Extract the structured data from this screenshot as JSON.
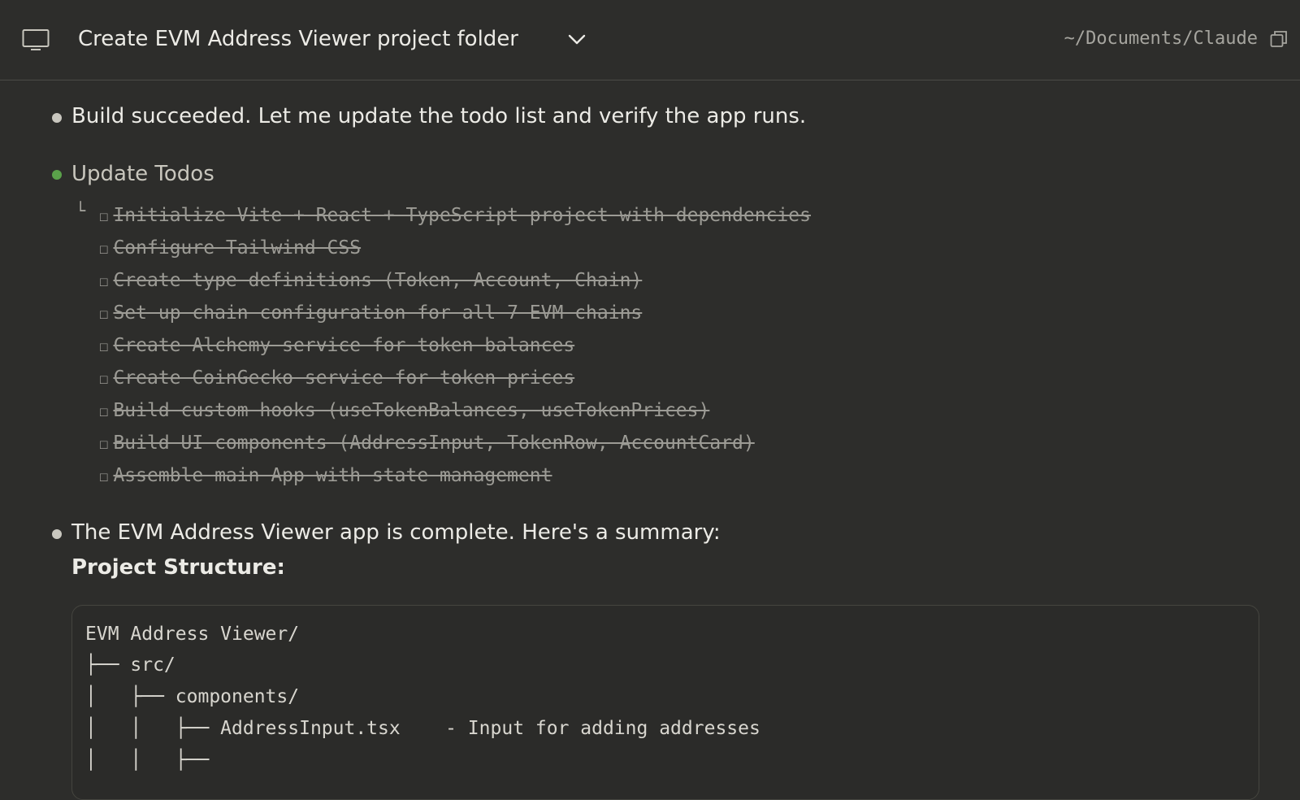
{
  "header": {
    "title": "Create EVM Address Viewer project folder",
    "path": "~/Documents/Claude",
    "icons": [
      "monitor-icon",
      "chevron-down-icon",
      "copy-icon"
    ]
  },
  "messages": {
    "build": "Build succeeded. Let me update the todo list and verify the app runs.",
    "tool_name": "Update Todos",
    "tool_elbow": "└",
    "summary": "The EVM Address Viewer app is complete. Here's a summary:",
    "section_title": "Project Structure:"
  },
  "todos": [
    {
      "box": "☐",
      "text": "Initialize Vite + React + TypeScript project with dependencies"
    },
    {
      "box": "☐",
      "text": "Configure Tailwind CSS"
    },
    {
      "box": "☐",
      "text": "Create type definitions (Token, Account, Chain)"
    },
    {
      "box": "☐",
      "text": "Set up chain configuration for all 7 EVM chains"
    },
    {
      "box": "☐",
      "text": "Create Alchemy service for token balances"
    },
    {
      "box": "☐",
      "text": "Create CoinGecko service for token prices"
    },
    {
      "box": "☐",
      "text": "Build custom hooks (useTokenBalances, useTokenPrices)"
    },
    {
      "box": "☐",
      "text": "Build UI components (AddressInput, TokenRow, AccountCard)"
    },
    {
      "box": "☐",
      "text": "Assemble main App with state management"
    }
  ],
  "code_block": {
    "lines": [
      "EVM Address Viewer/",
      "├── src/",
      "│   ├── components/",
      "│   │   ├── AddressInput.tsx    - Input for adding addresses"
    ]
  },
  "colors": {
    "background": "#2d2d2b",
    "bullet_default": "#c9c7bf",
    "bullet_success": "#5aa14a",
    "text": "#ecebe6",
    "muted": "#9c9b95"
  }
}
